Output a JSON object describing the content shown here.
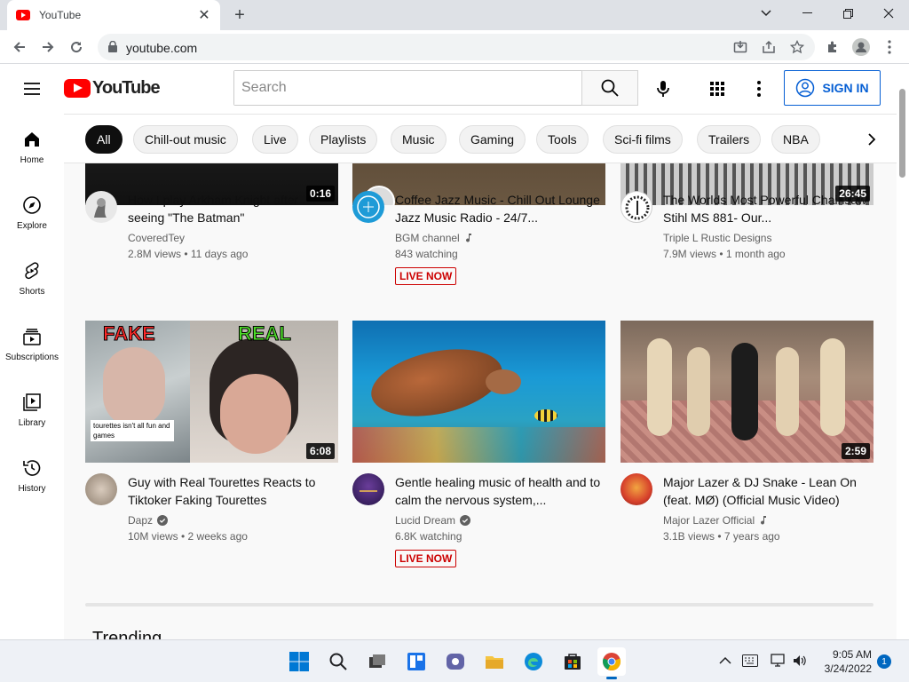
{
  "browser": {
    "tab_title": "YouTube",
    "url": "youtube.com"
  },
  "header": {
    "logo_text": "YouTube",
    "search_placeholder": "Search",
    "signin_label": "SIGN IN"
  },
  "sidebar": {
    "items": [
      {
        "label": "Home",
        "icon": "home-icon"
      },
      {
        "label": "Explore",
        "icon": "compass-icon"
      },
      {
        "label": "Shorts",
        "icon": "shorts-icon"
      },
      {
        "label": "Subscriptions",
        "icon": "subscriptions-icon"
      },
      {
        "label": "Library",
        "icon": "library-icon"
      },
      {
        "label": "History",
        "icon": "history-icon"
      }
    ]
  },
  "chips": [
    "All",
    "Chill-out music",
    "Live",
    "Playlists",
    "Music",
    "Gaming",
    "Tools",
    "Sci-fi films",
    "Trailers",
    "NBA"
  ],
  "videos": [
    {
      "title": "How I play Arkham Knight after seeing \"The Batman\"",
      "channel": "CoveredTey",
      "meta": "2.8M views • 11 days ago",
      "duration": "0:16"
    },
    {
      "title": "Coffee Jazz Music - Chill Out Lounge Jazz Music Radio - 24/7...",
      "channel": "BGM channel",
      "meta": "843 watching",
      "live": "LIVE NOW"
    },
    {
      "title": "The Worlds Most Powerful Chainsaw Stihl MS 881- Our...",
      "channel": "Triple L Rustic Designs",
      "meta": "7.9M views • 1 month ago",
      "duration": "26:45"
    },
    {
      "title": "Guy with Real Tourettes Reacts to Tiktoker Faking Tourettes",
      "channel": "Dapz",
      "meta": "10M views • 2 weeks ago",
      "duration": "6:08",
      "thumb_fake": "FAKE",
      "thumb_real": "REAL",
      "thumb_caption": "tourettes isn't all fun and games"
    },
    {
      "title": "Gentle healing music of health and to calm the nervous system,...",
      "channel": "Lucid Dream",
      "meta": "6.8K watching",
      "live": "LIVE NOW"
    },
    {
      "title": "Major Lazer & DJ Snake - Lean On (feat. MØ) (Official Music Video)",
      "channel": "Major Lazer Official",
      "meta": "3.1B views • 7 years ago",
      "duration": "2:59"
    }
  ],
  "section_heading": "Trending",
  "taskbar": {
    "time": "9:05 AM",
    "date": "3/24/2022",
    "notifications": "1"
  },
  "colors": {
    "brand_red": "#ff0000",
    "link_blue": "#065fd4",
    "live_red": "#cc0000"
  }
}
